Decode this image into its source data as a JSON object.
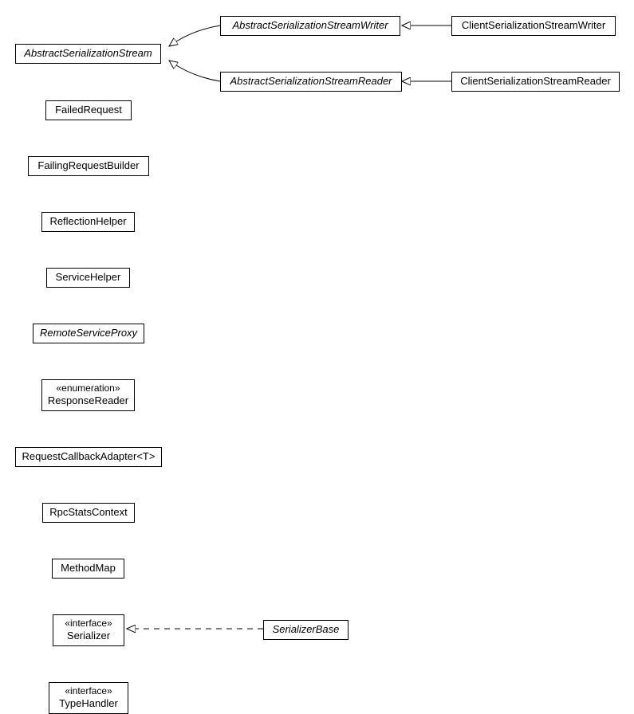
{
  "classes": {
    "abstractSerializationStream": "AbstractSerializationStream",
    "abstractSerializationStreamWriter": "AbstractSerializationStreamWriter",
    "abstractSerializationStreamReader": "AbstractSerializationStreamReader",
    "clientSerializationStreamWriter": "ClientSerializationStreamWriter",
    "clientSerializationStreamReader": "ClientSerializationStreamReader",
    "failedRequest": "FailedRequest",
    "failingRequestBuilder": "FailingRequestBuilder",
    "reflectionHelper": "ReflectionHelper",
    "serviceHelper": "ServiceHelper",
    "remoteServiceProxy": "RemoteServiceProxy",
    "enumerationStereotype": "«enumeration»",
    "responseReader": "ResponseReader",
    "requestCallbackAdapter": "RequestCallbackAdapter<T>",
    "rpcStatsContext": "RpcStatsContext",
    "methodMap": "MethodMap",
    "interfaceStereotype1": "«interface»",
    "serializer": "Serializer",
    "serializerBase": "SerializerBase",
    "interfaceStereotype2": "«interface»",
    "typeHandler": "TypeHandler"
  }
}
